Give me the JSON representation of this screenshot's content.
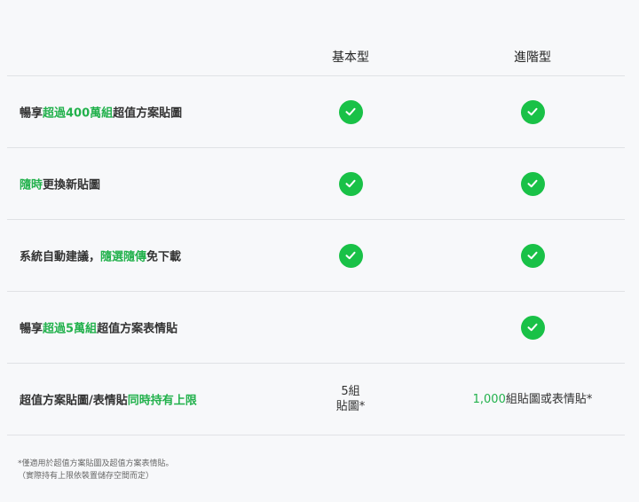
{
  "columns": {
    "basic": "基本型",
    "advanced": "進階型"
  },
  "rows": [
    {
      "label_pre": "暢享",
      "label_hl": "超過400萬組",
      "label_post": "超值方案貼圖",
      "basic": true,
      "advanced": true
    },
    {
      "label_pre": "",
      "label_hl": "隨時",
      "label_post": "更換新貼圖",
      "basic": true,
      "advanced": true
    },
    {
      "label_pre": "系統自動建議，",
      "label_hl": "隨選隨傳",
      "label_post": "免下載",
      "basic": true,
      "advanced": true
    },
    {
      "label_pre": "暢享",
      "label_hl": "超過5萬組",
      "label_post": "超值方案表情貼",
      "basic": false,
      "advanced": true
    },
    {
      "label_pre": "超值方案貼圖/表情貼",
      "label_hl": "同時持有上限",
      "label_post": "",
      "basic_text_line1": "5組",
      "basic_text_line2": "貼圖*",
      "advanced_num": "1,000",
      "advanced_text": "組貼圖或表情貼*"
    }
  ],
  "footnote": {
    "line1": "*僅適用於超值方案貼圖及超值方案表情貼。",
    "line2": "（實際持有上限依裝置儲存空間而定）"
  },
  "colors": {
    "accent": "#19c147",
    "highlight_text": "#22b14c"
  },
  "icons": {
    "check": "check-circle-icon"
  }
}
